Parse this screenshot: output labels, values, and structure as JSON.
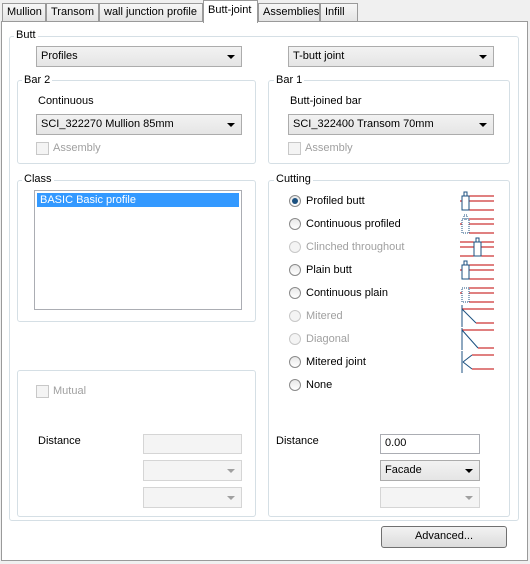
{
  "tabs": [
    "Mullion",
    "Transom",
    "wall junction profile",
    "Butt-joint",
    "Assemblies",
    "Infill"
  ],
  "butt": {
    "title": "Butt",
    "type_select": "Profiles",
    "joint_select": "T-butt joint"
  },
  "bar2": {
    "title": "Bar 2",
    "label": "Continuous",
    "select": "SCI_322270 Mullion 85mm",
    "assembly": "Assembly"
  },
  "bar1": {
    "title": "Bar 1",
    "label": "Butt-joined bar",
    "select": "SCI_322400 Transom 70mm",
    "assembly": "Assembly"
  },
  "class": {
    "title": "Class",
    "items": [
      "BASIC Basic profile"
    ]
  },
  "cutting": {
    "title": "Cutting",
    "options": [
      "Profiled butt",
      "Continuous profiled",
      "Clinched throughout",
      "Plain butt",
      "Continuous plain",
      "Mitered",
      "Diagonal",
      "Mitered joint",
      "None"
    ]
  },
  "left_bottom": {
    "mutual": "Mutual",
    "distance_label": "Distance"
  },
  "right_bottom": {
    "distance_label": "Distance",
    "distance_value": "0.00",
    "side_select": "Facade"
  },
  "advanced_button": "Advanced...",
  "colors": {
    "selection": "#3399ff",
    "icon_line": "#c00000",
    "icon_profile": "#1c5180"
  }
}
